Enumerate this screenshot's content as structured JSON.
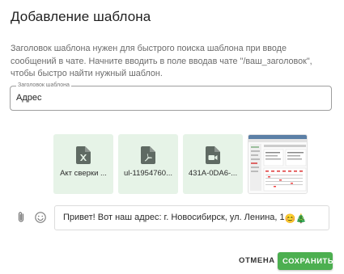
{
  "dialog": {
    "title": "Добавление шаблона",
    "description": "Заголовок шаблона нужен для быстрого поиска шаблона при вводе сообщений в чате. Начните вводить в поле вводав чате \"/ваш_заголовок\", чтобы быстро найти нужный шаблон."
  },
  "title_field": {
    "label": "Заголовок шаблона",
    "value": "Адрес"
  },
  "attachments": [
    {
      "name": "Акт сверки ...",
      "icon": "excel-file-icon"
    },
    {
      "name": "ul-11954760...",
      "icon": "pdf-file-icon"
    },
    {
      "name": "431A-0DA6-...",
      "icon": "video-file-icon"
    },
    {
      "name": "",
      "icon": "image-thumbnail"
    }
  ],
  "composer": {
    "attach_icon": "paperclip-icon",
    "emoji_icon": "smiley-icon",
    "message": "Привет! Вот наш адрес: г. Новосибирск, ул. Ленина, 1",
    "message_emojis": "😊🎄"
  },
  "actions": {
    "cancel_label": "ОТМЕНА",
    "save_label": "СОХРАНИТЬ"
  },
  "colors": {
    "accent": "#4caf50",
    "attachment_bg": "#e6f3e7"
  }
}
